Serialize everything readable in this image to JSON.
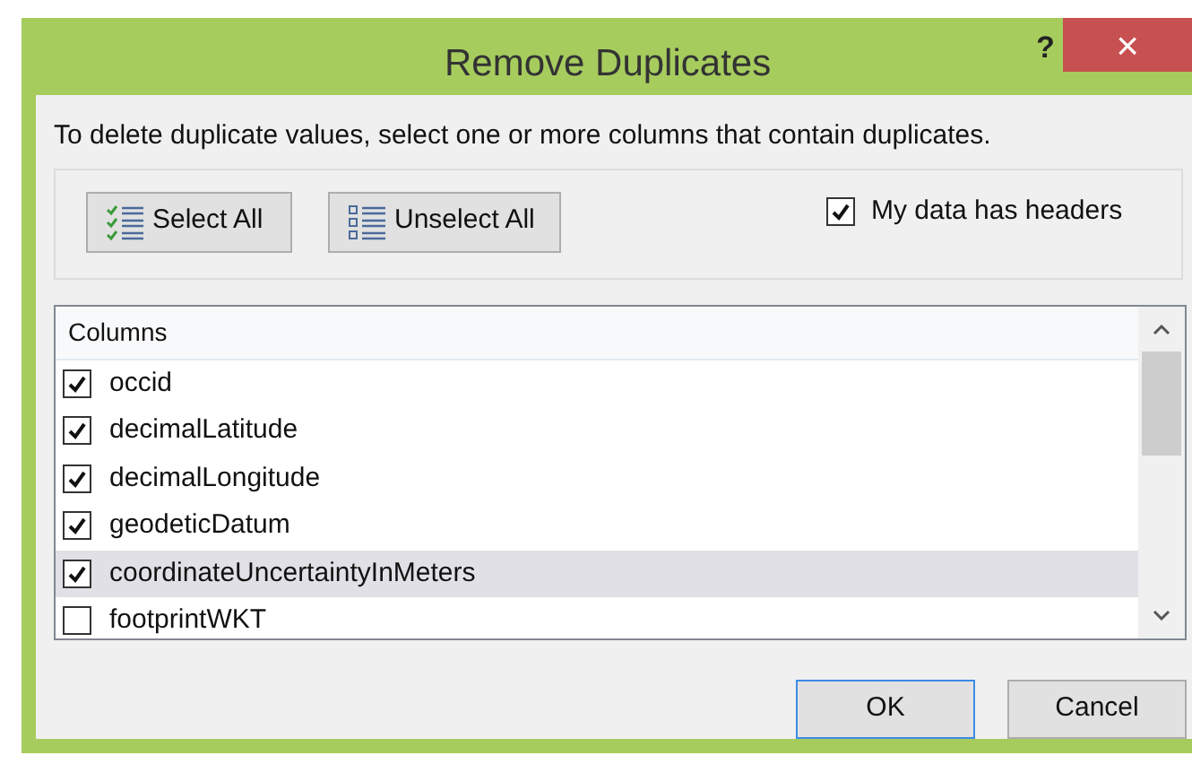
{
  "window": {
    "title": "Remove Duplicates",
    "help": "?",
    "close": "×"
  },
  "instruction": "To delete duplicate values, select one or more columns that contain duplicates.",
  "select_all": "Select All",
  "unselect_all": "Unselect All",
  "headers_option": {
    "label": "My data has headers",
    "checked": true
  },
  "columns_list": {
    "header": "Columns",
    "items": [
      {
        "label": "occid",
        "checked": true,
        "selected": false
      },
      {
        "label": "decimalLatitude",
        "checked": true,
        "selected": false
      },
      {
        "label": "decimalLongitude",
        "checked": true,
        "selected": false
      },
      {
        "label": "geodeticDatum",
        "checked": true,
        "selected": false
      },
      {
        "label": "coordinateUncertaintyInMeters",
        "checked": true,
        "selected": true
      },
      {
        "label": "footprintWKT",
        "checked": false,
        "selected": false
      }
    ]
  },
  "buttons": [
    {
      "label": "OK",
      "default": true
    },
    {
      "label": "Cancel",
      "default": false
    }
  ]
}
